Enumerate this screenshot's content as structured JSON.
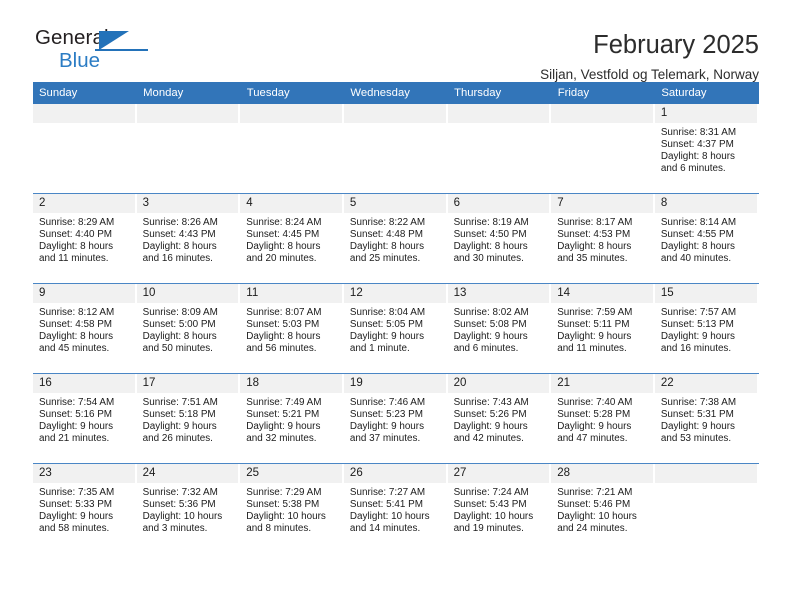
{
  "brand": {
    "name_dark": "General",
    "name_blue": "Blue",
    "accent_color": "#2372b9"
  },
  "header": {
    "title": "February 2025",
    "location": "Siljan, Vestfold og Telemark, Norway"
  },
  "calendar": {
    "header_bg": "#3275b9",
    "daynum_bg": "#f1f1f1",
    "weekday_names": [
      "Sunday",
      "Monday",
      "Tuesday",
      "Wednesday",
      "Thursday",
      "Friday",
      "Saturday"
    ],
    "weeks": [
      [
        {
          "empty": true
        },
        {
          "empty": true
        },
        {
          "empty": true
        },
        {
          "empty": true
        },
        {
          "empty": true
        },
        {
          "empty": true
        },
        {
          "day": "1",
          "sunrise": "Sunrise: 8:31 AM",
          "sunset": "Sunset: 4:37 PM",
          "daylight1": "Daylight: 8 hours",
          "daylight2": "and 6 minutes."
        }
      ],
      [
        {
          "day": "2",
          "sunrise": "Sunrise: 8:29 AM",
          "sunset": "Sunset: 4:40 PM",
          "daylight1": "Daylight: 8 hours",
          "daylight2": "and 11 minutes."
        },
        {
          "day": "3",
          "sunrise": "Sunrise: 8:26 AM",
          "sunset": "Sunset: 4:43 PM",
          "daylight1": "Daylight: 8 hours",
          "daylight2": "and 16 minutes."
        },
        {
          "day": "4",
          "sunrise": "Sunrise: 8:24 AM",
          "sunset": "Sunset: 4:45 PM",
          "daylight1": "Daylight: 8 hours",
          "daylight2": "and 20 minutes."
        },
        {
          "day": "5",
          "sunrise": "Sunrise: 8:22 AM",
          "sunset": "Sunset: 4:48 PM",
          "daylight1": "Daylight: 8 hours",
          "daylight2": "and 25 minutes."
        },
        {
          "day": "6",
          "sunrise": "Sunrise: 8:19 AM",
          "sunset": "Sunset: 4:50 PM",
          "daylight1": "Daylight: 8 hours",
          "daylight2": "and 30 minutes."
        },
        {
          "day": "7",
          "sunrise": "Sunrise: 8:17 AM",
          "sunset": "Sunset: 4:53 PM",
          "daylight1": "Daylight: 8 hours",
          "daylight2": "and 35 minutes."
        },
        {
          "day": "8",
          "sunrise": "Sunrise: 8:14 AM",
          "sunset": "Sunset: 4:55 PM",
          "daylight1": "Daylight: 8 hours",
          "daylight2": "and 40 minutes."
        }
      ],
      [
        {
          "day": "9",
          "sunrise": "Sunrise: 8:12 AM",
          "sunset": "Sunset: 4:58 PM",
          "daylight1": "Daylight: 8 hours",
          "daylight2": "and 45 minutes."
        },
        {
          "day": "10",
          "sunrise": "Sunrise: 8:09 AM",
          "sunset": "Sunset: 5:00 PM",
          "daylight1": "Daylight: 8 hours",
          "daylight2": "and 50 minutes."
        },
        {
          "day": "11",
          "sunrise": "Sunrise: 8:07 AM",
          "sunset": "Sunset: 5:03 PM",
          "daylight1": "Daylight: 8 hours",
          "daylight2": "and 56 minutes."
        },
        {
          "day": "12",
          "sunrise": "Sunrise: 8:04 AM",
          "sunset": "Sunset: 5:05 PM",
          "daylight1": "Daylight: 9 hours",
          "daylight2": "and 1 minute."
        },
        {
          "day": "13",
          "sunrise": "Sunrise: 8:02 AM",
          "sunset": "Sunset: 5:08 PM",
          "daylight1": "Daylight: 9 hours",
          "daylight2": "and 6 minutes."
        },
        {
          "day": "14",
          "sunrise": "Sunrise: 7:59 AM",
          "sunset": "Sunset: 5:11 PM",
          "daylight1": "Daylight: 9 hours",
          "daylight2": "and 11 minutes."
        },
        {
          "day": "15",
          "sunrise": "Sunrise: 7:57 AM",
          "sunset": "Sunset: 5:13 PM",
          "daylight1": "Daylight: 9 hours",
          "daylight2": "and 16 minutes."
        }
      ],
      [
        {
          "day": "16",
          "sunrise": "Sunrise: 7:54 AM",
          "sunset": "Sunset: 5:16 PM",
          "daylight1": "Daylight: 9 hours",
          "daylight2": "and 21 minutes."
        },
        {
          "day": "17",
          "sunrise": "Sunrise: 7:51 AM",
          "sunset": "Sunset: 5:18 PM",
          "daylight1": "Daylight: 9 hours",
          "daylight2": "and 26 minutes."
        },
        {
          "day": "18",
          "sunrise": "Sunrise: 7:49 AM",
          "sunset": "Sunset: 5:21 PM",
          "daylight1": "Daylight: 9 hours",
          "daylight2": "and 32 minutes."
        },
        {
          "day": "19",
          "sunrise": "Sunrise: 7:46 AM",
          "sunset": "Sunset: 5:23 PM",
          "daylight1": "Daylight: 9 hours",
          "daylight2": "and 37 minutes."
        },
        {
          "day": "20",
          "sunrise": "Sunrise: 7:43 AM",
          "sunset": "Sunset: 5:26 PM",
          "daylight1": "Daylight: 9 hours",
          "daylight2": "and 42 minutes."
        },
        {
          "day": "21",
          "sunrise": "Sunrise: 7:40 AM",
          "sunset": "Sunset: 5:28 PM",
          "daylight1": "Daylight: 9 hours",
          "daylight2": "and 47 minutes."
        },
        {
          "day": "22",
          "sunrise": "Sunrise: 7:38 AM",
          "sunset": "Sunset: 5:31 PM",
          "daylight1": "Daylight: 9 hours",
          "daylight2": "and 53 minutes."
        }
      ],
      [
        {
          "day": "23",
          "sunrise": "Sunrise: 7:35 AM",
          "sunset": "Sunset: 5:33 PM",
          "daylight1": "Daylight: 9 hours",
          "daylight2": "and 58 minutes."
        },
        {
          "day": "24",
          "sunrise": "Sunrise: 7:32 AM",
          "sunset": "Sunset: 5:36 PM",
          "daylight1": "Daylight: 10 hours",
          "daylight2": "and 3 minutes."
        },
        {
          "day": "25",
          "sunrise": "Sunrise: 7:29 AM",
          "sunset": "Sunset: 5:38 PM",
          "daylight1": "Daylight: 10 hours",
          "daylight2": "and 8 minutes."
        },
        {
          "day": "26",
          "sunrise": "Sunrise: 7:27 AM",
          "sunset": "Sunset: 5:41 PM",
          "daylight1": "Daylight: 10 hours",
          "daylight2": "and 14 minutes."
        },
        {
          "day": "27",
          "sunrise": "Sunrise: 7:24 AM",
          "sunset": "Sunset: 5:43 PM",
          "daylight1": "Daylight: 10 hours",
          "daylight2": "and 19 minutes."
        },
        {
          "day": "28",
          "sunrise": "Sunrise: 7:21 AM",
          "sunset": "Sunset: 5:46 PM",
          "daylight1": "Daylight: 10 hours",
          "daylight2": "and 24 minutes."
        },
        {
          "empty": true
        }
      ]
    ]
  }
}
